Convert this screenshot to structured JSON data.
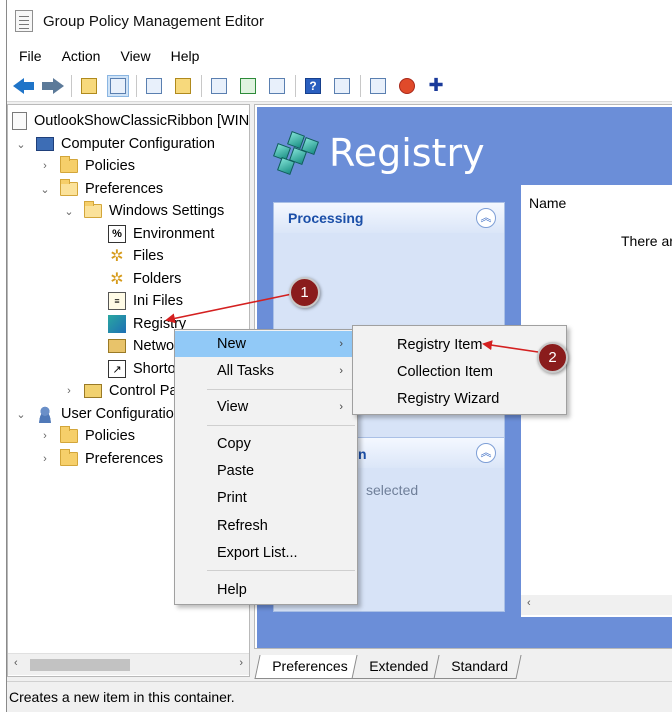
{
  "window": {
    "title": "Group Policy Management Editor"
  },
  "menu": [
    "File",
    "Action",
    "View",
    "Help"
  ],
  "tree": {
    "root": "OutlookShowClassicRibbon [WIN",
    "computer_config": "Computer Configuration",
    "policies": "Policies",
    "preferences": "Preferences",
    "windows_settings": "Windows Settings",
    "environment": "Environment",
    "files": "Files",
    "folders": "Folders",
    "ini_files": "Ini Files",
    "registry": "Registry",
    "network": "Netwo",
    "shortcuts": "Shorto",
    "control_panel": "Control Pa",
    "user_config": "User Configuratio",
    "user_policies": "Policies",
    "user_preferences": "Preferences"
  },
  "content": {
    "banner_title": "Registry",
    "processing_header": "Processing",
    "desc_header_fragment": "n",
    "desc_text": "selected",
    "list_column_name": "Name",
    "list_message": "There are"
  },
  "tabs": [
    "Preferences",
    "Extended",
    "Standard"
  ],
  "context_menu": {
    "new": "New",
    "all_tasks": "All Tasks",
    "view": "View",
    "copy": "Copy",
    "paste": "Paste",
    "print": "Print",
    "refresh": "Refresh",
    "export_list": "Export List...",
    "help": "Help"
  },
  "submenu": {
    "registry_item": "Registry Item",
    "collection_item": "Collection Item",
    "registry_wizard": "Registry Wizard"
  },
  "callouts": {
    "one": "1",
    "two": "2"
  },
  "status": "Creates a new item in this container.",
  "colors": {
    "content_blue": "#6b8ed8",
    "menu_highlight": "#91c9f7",
    "callout_red": "#8a1c1c",
    "arrow_red": "#d42020"
  }
}
